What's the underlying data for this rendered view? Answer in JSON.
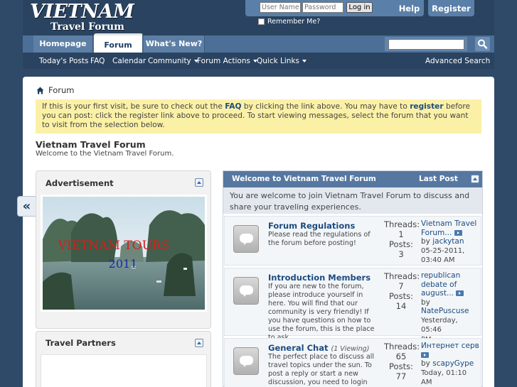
{
  "header": {
    "logo_line1": "VIETNAM",
    "logo_line2": "Travel Forum",
    "login": {
      "username_placeholder": "User Name",
      "password_placeholder": "Password",
      "login_label": "Log in",
      "remember_label": "Remember Me?"
    },
    "help_label": "Help",
    "register_label": "Register"
  },
  "nav": {
    "tabs": [
      {
        "label": "Homepage"
      },
      {
        "label": "Forum",
        "active": true
      },
      {
        "label": "What's New?"
      }
    ],
    "search_placeholder": "",
    "subnav": [
      {
        "label": "Today's Posts",
        "dropdown": false
      },
      {
        "label": "FAQ",
        "dropdown": false
      },
      {
        "label": "Calendar",
        "dropdown": false
      },
      {
        "label": "Community",
        "dropdown": true
      },
      {
        "label": "Forum Actions",
        "dropdown": true
      },
      {
        "label": "Quick Links",
        "dropdown": true
      }
    ],
    "advanced_search": "Advanced Search"
  },
  "breadcrumb": {
    "home_icon": "home-icon",
    "current": "Forum"
  },
  "notice": {
    "part1": "If this is your first visit, be sure to check out the ",
    "faq": "FAQ",
    "part2": " by clicking the link above. You may have to ",
    "register": "register",
    "part3": " before you can post: click the register link above to proceed. To start viewing messages, select the forum that you want to visit from the selection below."
  },
  "forum": {
    "title": "Vietnam Travel Forum",
    "description": "Welcome to the Vietnam Travel Forum."
  },
  "sidebar": {
    "collapse_glyph": "«",
    "advertisement": {
      "heading": "Advertisement",
      "image_text_line1": "VIETNAM TOURS",
      "image_text_line2": "2011"
    },
    "partners": {
      "heading": "Travel Partners"
    }
  },
  "forum_table": {
    "header_title": "Welcome to Vietnam Travel Forum",
    "header_last_post": "Last Post",
    "description": "You are welcome to join Vietnam Travel Forum to discuss and share your traveling experiences.",
    "rows": [
      {
        "title": "Forum Regulations",
        "viewing": "",
        "description": "Please read the regulations of the forum before posting!",
        "threads_label": "Threads:",
        "threads": "1",
        "posts_label": "Posts:",
        "posts": "3",
        "last_title": "Vietnam Travel Forum...",
        "last_by": "by",
        "last_user": "jackytan",
        "last_date": "05-25-2011,",
        "last_time": "03:40 AM"
      },
      {
        "title": "Introduction Members",
        "viewing": "",
        "description": "If you are new to the forum, please introduce yourself in here. You will find that our community is very friendly! If you have questions on how to use the forum, this is the place to ask.",
        "threads_label": "Threads:",
        "threads": "7",
        "posts_label": "Posts:",
        "posts": "14",
        "last_title": "republican debate of august...",
        "last_by": "by",
        "last_user": "NatePuscuse",
        "last_date": "Yesterday, 05:46",
        "last_time": "PM"
      },
      {
        "title": "General Chat",
        "viewing": "(1 Viewing)",
        "description": "The perfect place to discuss all travel topics under the sun. To post a reply or start a new discussion, you need to login the forum.",
        "threads_label": "Threads:",
        "threads": "65",
        "posts_label": "Posts:",
        "posts": "77",
        "last_title": "Интернет серв",
        "last_by": "by",
        "last_user": "scapyGype",
        "last_date": "Today, 01:10 AM",
        "last_time": ""
      }
    ]
  },
  "colors": {
    "page_bg": "#2f4a68",
    "nav_bg": "#4b6f97",
    "link": "#1c4b80",
    "notice_bg": "#fbf1a6",
    "table_header": "#5677a0"
  }
}
